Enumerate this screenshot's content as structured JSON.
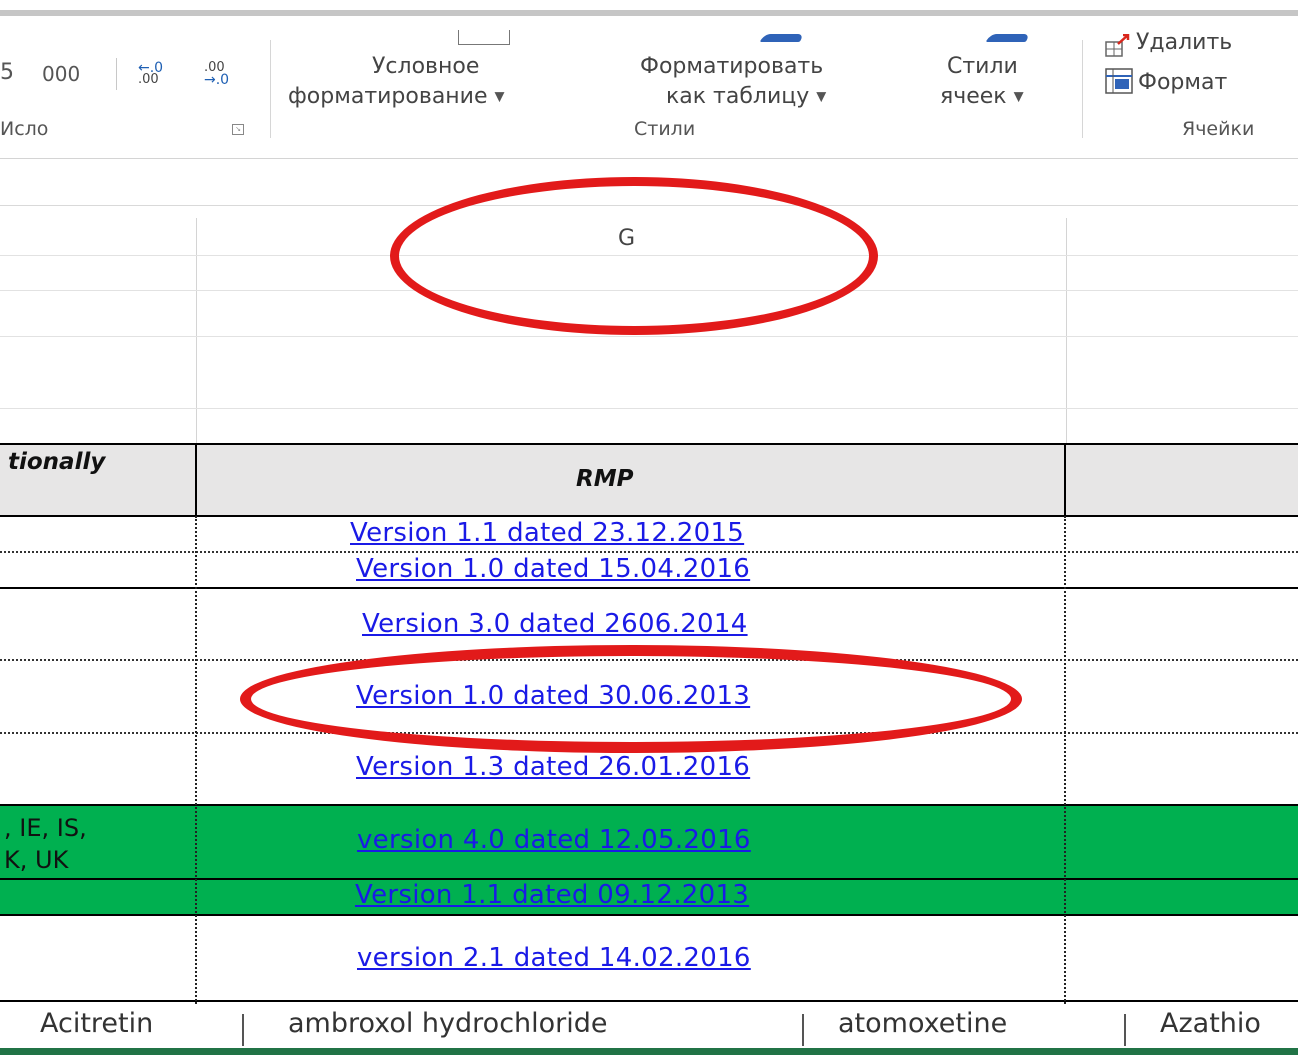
{
  "ribbon": {
    "number_group": {
      "format_partial": "5",
      "thousands": "000",
      "increase_decimal_top": "←.0",
      "increase_decimal_bottom": ".00",
      "decrease_decimal_top": ".00",
      "decrease_decimal_bottom": "→.0",
      "label": "Число",
      "label_partial": "Исло"
    },
    "styles_group": {
      "conditional_line1": "Условное",
      "conditional_line2": "форматирование",
      "format_table_line1": "Форматировать",
      "format_table_line2": "как таблицу",
      "cell_styles_line1": "Стили",
      "cell_styles_line2": "ячеек",
      "label": "Стили"
    },
    "cells_group": {
      "delete": "Удалить",
      "format": "Формат",
      "label": "Ячейки"
    }
  },
  "sheet": {
    "column_header": "G",
    "header_row": {
      "left_partial": "tionally",
      "rmp": "RMP"
    },
    "rmp_links": [
      "Version 1.1 dated  23.12.2015",
      "Version 1.0 dated 15.04.2016",
      "Version 3.0 dated 2606.2014",
      "Version 1.0 dated 30.06.2013",
      "Version 1.3 dated 26.01.2016",
      "version 4.0 dated 12.05.2016",
      "Version 1.1 dated 09.12.2013",
      "version 2.1 dated 14.02.2016"
    ],
    "countries_line1": ", IE, IS,",
    "countries_line2": "K, UK"
  },
  "tabs": [
    "Acitretin",
    "ambroxol hydrochloride",
    "atomoxetine",
    "Azathio"
  ],
  "colors": {
    "header_fill": "#e7e6e6",
    "green_fill": "#00b050",
    "link": "#1a1ae6",
    "annotation": "#e21a1a"
  }
}
